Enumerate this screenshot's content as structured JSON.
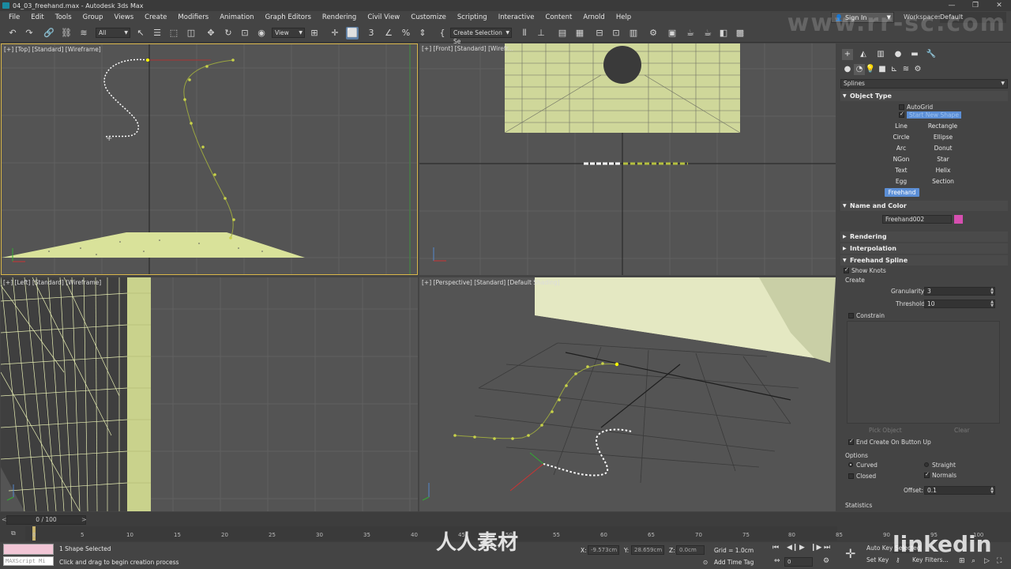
{
  "window": {
    "title": "04_03_freehand.max - Autodesk 3ds Max",
    "controls": [
      "—",
      "❐",
      "✕"
    ]
  },
  "menu": [
    "File",
    "Edit",
    "Tools",
    "Group",
    "Views",
    "Create",
    "Modifiers",
    "Animation",
    "Graph Editors",
    "Rendering",
    "Civil View",
    "Customize",
    "Scripting",
    "Interactive",
    "Content",
    "Arnold",
    "Help"
  ],
  "account": {
    "signin": "Sign In",
    "workspaces_label": "Workspaces:",
    "workspace": "Default"
  },
  "toolbar": {
    "filter": "All",
    "view": "View",
    "selection_set": "Create Selection Se"
  },
  "viewports": {
    "top": "[+] [Top] [Standard] [Wireframe]",
    "front": "[+] [Front] [Standard] [Wirefr...",
    "left": "[+] [Left] [Standard] [Wireframe]",
    "perspective": "[+] [Perspective] [Standard] [Default Shading]"
  },
  "command_panel": {
    "category": "Splines",
    "object_type": {
      "title": "Object Type",
      "autogrid": "AutoGrid",
      "start_new_shape": "Start New Shape",
      "buttons": [
        "Line",
        "Rectangle",
        "Circle",
        "Ellipse",
        "Arc",
        "Donut",
        "NGon",
        "Star",
        "Text",
        "Helix",
        "Egg",
        "Section",
        "Freehand"
      ],
      "selected": "Freehand"
    },
    "name_and_color": {
      "title": "Name and Color",
      "name": "Freehand002",
      "color": "#d64fb0"
    },
    "rendering": "Rendering",
    "interpolation": "Interpolation",
    "freehand_spline": {
      "title": "Freehand Spline",
      "show_knots": "Show Knots",
      "create": "Create",
      "granularity_label": "Granularity:",
      "granularity": "3",
      "threshold_label": "Threshold:",
      "threshold": "10",
      "constrain": "Constrain",
      "pick_object": "Pick Object",
      "clear": "Clear",
      "end_create": "End Create On Button Up",
      "options": "Options",
      "curved": "Curved",
      "straight": "Straight",
      "closed": "Closed",
      "normals": "Normals",
      "offset_label": "Offset:",
      "offset": "0.1"
    },
    "statistics": "Statistics"
  },
  "timeline": {
    "frame": "0 / 100",
    "ticks": [
      "0",
      "5",
      "10",
      "15",
      "20",
      "25",
      "30",
      "35",
      "40",
      "45",
      "50",
      "55",
      "60",
      "65",
      "70",
      "75",
      "80",
      "85",
      "90",
      "95",
      "100"
    ]
  },
  "status": {
    "maxscript": "MAXScript Mi",
    "selected": "1 Shape Selected",
    "prompt": "Click and drag to begin creation process",
    "x_label": "X:",
    "x": "-9.573cm",
    "y_label": "Y:",
    "y": "28.659cm",
    "z_label": "Z:",
    "z": "0.0cm",
    "grid": "Grid = 1.0cm",
    "add_time_tag": "Add Time Tag",
    "auto_key": "Auto Key",
    "set_key": "Set Key",
    "selected_btn": "Selected",
    "key_filters": "Key Filters...",
    "frame_field": "0"
  },
  "watermarks": {
    "site": "www.rr-sc.com",
    "center": "人人素材",
    "brand": "linkedin"
  }
}
